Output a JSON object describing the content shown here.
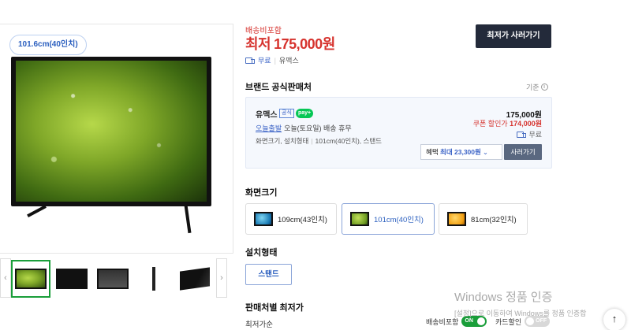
{
  "gallery": {
    "size_badge": "101.6cm(40인치)",
    "prev_arrow": "‹",
    "next_arrow": "›"
  },
  "product": {
    "shipping_included_label": "배송비포함",
    "price_prefix": "최저",
    "price": "175,000원",
    "buy_button": "최저가 사러가기",
    "shipping_free": "무료",
    "seller_short": "유맥스"
  },
  "official_seller": {
    "section_title": "브랜드 공식판매처",
    "criteria_label": "기준",
    "name": "유맥스",
    "official_badge": "공식",
    "npay_badge": "pay+",
    "delivery_today": "오늘출발",
    "delivery_text": "오늘(토요일) 배송 휴무",
    "spec_label": "화면크기, 설치형태",
    "spec_value": "101cm(40인치), 스탠드",
    "price": "175,000원",
    "coupon_label": "쿠폰 할인가",
    "coupon_price": "174,000원",
    "shipping": "무료",
    "benefit_label": "혜택",
    "benefit_value": "최대 23,300원",
    "go_button": "사러가기"
  },
  "screen_size": {
    "title": "화면크기",
    "options": [
      {
        "label": "109cm(43인치)",
        "image": "blue"
      },
      {
        "label": "101cm(40인치)",
        "image": "green",
        "selected": true
      },
      {
        "label": "81cm(32인치)",
        "image": "yellow"
      }
    ]
  },
  "install": {
    "title": "설치형태",
    "option": "스탠드"
  },
  "lowest_by_seller": {
    "title": "판매처별 최저가",
    "sort_label": "최저가순",
    "toggle_shipping_label": "배송비포함",
    "toggle_shipping_state": "ON",
    "toggle_card_label": "카드할인",
    "toggle_card_state": "OFF"
  },
  "windows_watermark": {
    "title": "Windows 정품 인증",
    "subtitle": "[설정]으로 이동하여 Windows를 정품 인증합"
  },
  "top_button": "↑"
}
